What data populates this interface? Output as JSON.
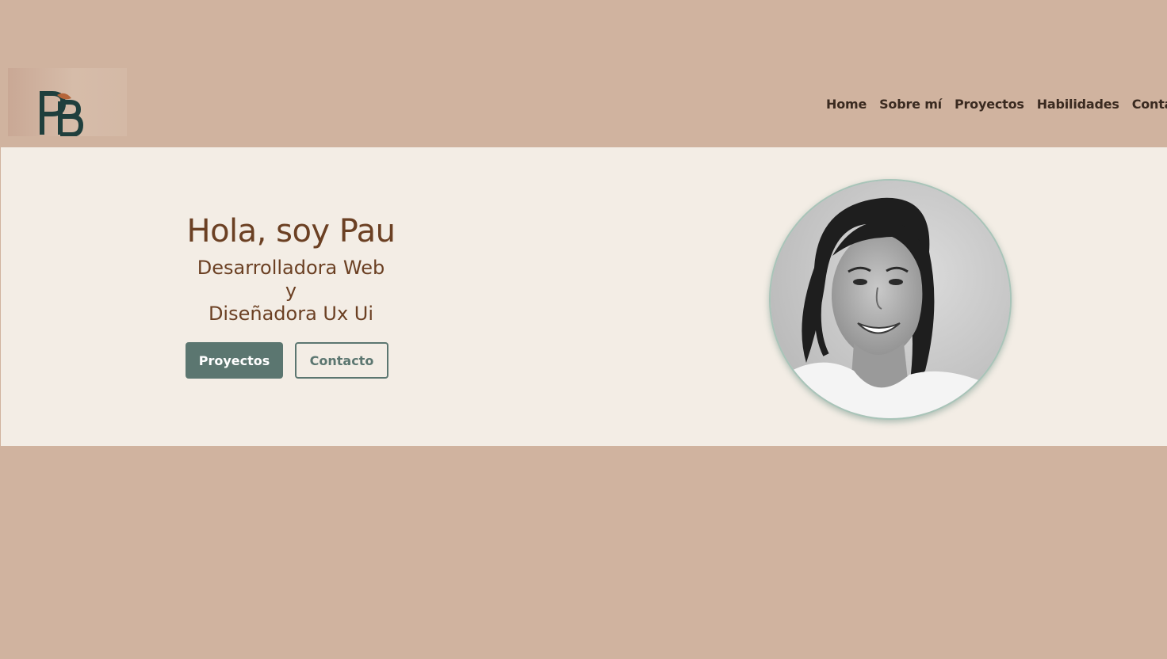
{
  "logo": {
    "text": "PB"
  },
  "nav": {
    "items": [
      {
        "label": "Home"
      },
      {
        "label": "Sobre mí"
      },
      {
        "label": "Proyectos"
      },
      {
        "label": "Habilidades"
      },
      {
        "label": "Contacto"
      }
    ]
  },
  "hero": {
    "title": "Hola, soy Pau",
    "subtitle_line1": "Desarrolladora Web",
    "subtitle_line2": "y",
    "subtitle_line3": "Diseñadora Ux Ui",
    "primary_button": "Proyectos",
    "secondary_button": "Contacto"
  },
  "colors": {
    "background": "#d0b39f",
    "hero_background": "#f3ede5",
    "text_brown": "#6b4023",
    "accent_green": "#5b7670",
    "nav_text": "#3a2a20"
  }
}
